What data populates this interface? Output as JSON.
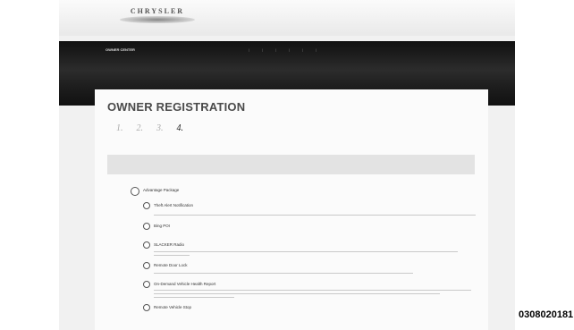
{
  "brand": {
    "logo_text": "CHRYSLER"
  },
  "top_links": [
    "",
    "",
    ""
  ],
  "nav": {
    "title": "OWNER CENTER",
    "items": [
      "",
      "",
      "",
      "",
      "",
      "",
      ""
    ]
  },
  "page": {
    "title": "OWNER REGISTRATION",
    "steps": [
      {
        "num": "1.",
        "label": ""
      },
      {
        "num": "2.",
        "label": ""
      },
      {
        "num": "3.",
        "label": ""
      },
      {
        "num": "4.",
        "label": ""
      }
    ],
    "active_step": 4,
    "intro": "",
    "package_header": "",
    "package": {
      "name": "Advantage Package",
      "price": ""
    },
    "options": [
      {
        "name": "Theft Alert Notification",
        "sub": ""
      },
      {
        "name": "Bing POI",
        "sub": ""
      },
      {
        "name": "SLACKER Radio",
        "sub": ""
      },
      {
        "name": "Remote Door Lock",
        "sub": ""
      },
      {
        "name": "On-Demand Vehicle Health Report",
        "sub": ""
      },
      {
        "name": "Remote Vehicle Stop",
        "sub": ""
      }
    ]
  },
  "figure_code": "0308020181"
}
